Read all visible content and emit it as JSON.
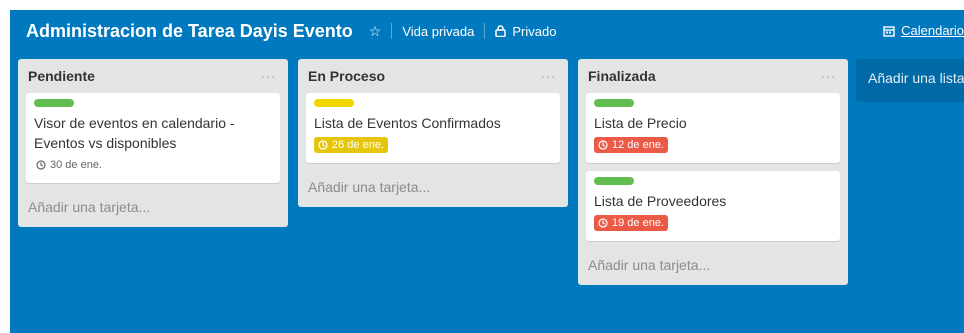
{
  "board": {
    "title": "Administracion de Tarea Dayis Evento",
    "visibility_label": "Vida privada",
    "privacy_label": "Privado",
    "calendar_label": "Calendario",
    "background_color": "#0079bf"
  },
  "lists": [
    {
      "title": "Pendiente",
      "menu": "···",
      "cards": [
        {
          "label_color": "#61bd4f",
          "title": "Visor de eventos en calendario - Eventos vs disponibles",
          "due": "30 de ene.",
          "due_style": "plain"
        }
      ],
      "add_card": "Añadir una tarjeta..."
    },
    {
      "title": "En Proceso",
      "menu": "···",
      "cards": [
        {
          "label_color": "#f2d600",
          "title": "Lista de Eventos Confirmados",
          "due": "26 de ene.",
          "due_style": "yellow"
        }
      ],
      "add_card": "Añadir una tarjeta..."
    },
    {
      "title": "Finalizada",
      "menu": "···",
      "cards": [
        {
          "label_color": "#61bd4f",
          "title": "Lista de Precio",
          "due": "12 de ene.",
          "due_style": "red"
        },
        {
          "label_color": "#61bd4f",
          "title": "Lista de Proveedores",
          "due": "19 de ene.",
          "due_style": "red"
        }
      ],
      "add_card": "Añadir una tarjeta..."
    }
  ],
  "add_list": "Añadir una lista..."
}
